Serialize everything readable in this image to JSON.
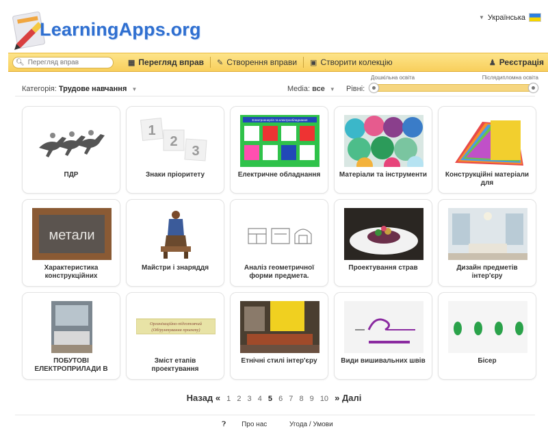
{
  "brand": {
    "name": "LearningApps.org"
  },
  "language": {
    "label": "Українська"
  },
  "nav": {
    "search_placeholder": "Перегляд вправ",
    "browse": "Перегляд вправ",
    "create": "Створення вправи",
    "collection": "Створити колекцію",
    "register": "Реєстрація"
  },
  "filters": {
    "category_label": "Категорія:",
    "category_value": "Трудове навчання",
    "media_label": "Media:",
    "media_value": "все",
    "levels_label": "Рівні:",
    "level_min": "Дошкільна освіта",
    "level_max": "Післядипломна освіта"
  },
  "tiles": [
    {
      "title": "ПДР"
    },
    {
      "title": "Знаки пріоритету"
    },
    {
      "title": "Електричне обладнання"
    },
    {
      "title": "Матеріали та інструменти"
    },
    {
      "title": "Конструкційні матеріали для"
    },
    {
      "title": "Характеристика конструкційних"
    },
    {
      "title": "Майстри і знаряддя"
    },
    {
      "title": "Аналіз геометричної форми предмета."
    },
    {
      "title": "Проектування страв"
    },
    {
      "title": "Дизайн предметів інтер'єру"
    },
    {
      "title": "ПОБУТОВІ ЕЛЕКТРОПРИЛАДИ В"
    },
    {
      "title": "Зміст етапів проектування"
    },
    {
      "title": "Етнічні стилі інтер'єру"
    },
    {
      "title": "Види вишивальних швів"
    },
    {
      "title": "Бісер"
    }
  ],
  "thumb_text": {
    "priority_1": "1",
    "priority_2": "2",
    "priority_3": "3",
    "electric_banner": "Електроенергія та електрообладнання",
    "metals": "метали",
    "stage_line1": "Організаційно-підготовчий",
    "stage_line2": "(Обґрунтування проекту)"
  },
  "pager": {
    "prev": "Назад «",
    "pages": [
      "1",
      "2",
      "3",
      "4",
      "5",
      "6",
      "7",
      "8",
      "9",
      "10"
    ],
    "current": "5",
    "next": "» Далі"
  },
  "footer": {
    "about": "Про нас",
    "terms": "Угода / Умови"
  },
  "colors": {
    "brand_blue": "#2f6fd0",
    "nav_yellow": "#f8cf5c"
  }
}
